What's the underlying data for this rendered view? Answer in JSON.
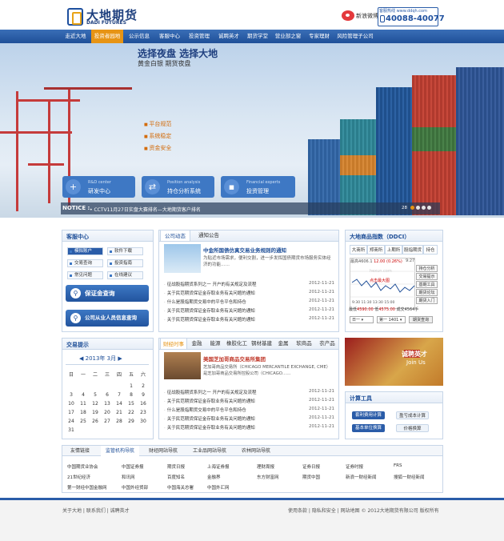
{
  "header": {
    "logo_cn": "大地期货",
    "logo_en": "DADI FUTURES",
    "weibo": "新浪微博",
    "hotline_top": "客服热线 www.ddqh.com",
    "hotline": "40088-40077"
  },
  "nav": [
    "走近大地",
    "投资者园地",
    "公示信息",
    "客服中心",
    "投资管理",
    "诚聘英才",
    "期货学堂",
    "营业部之窗",
    "专家理财",
    "风险管理子公司"
  ],
  "banner": {
    "title": "选择夜盘  选择大地",
    "subtitle": "黄金白银  期货夜盘",
    "bullets": [
      "平台规范",
      "系统稳定",
      "资金安全"
    ],
    "buttons": [
      {
        "en": "R&D center",
        "cn": "研发中心",
        "icon": "+"
      },
      {
        "en": "Position analysis",
        "cn": "持仓分析系统",
        "icon": "⇄"
      },
      {
        "en": "Financial experts",
        "cn": "投资管理",
        "icon": "▪"
      }
    ],
    "notice_label": "NOTICE :",
    "notice_text": "• CCTV11月27日实盘大赛排名—大地期货客户排名",
    "page_no": "28"
  },
  "service": {
    "title": "客服中心",
    "items": [
      "模拟账户",
      "软件下载",
      "交易查询",
      "投资指南",
      "常见问题",
      "在线建议"
    ],
    "query_btn": "保证金查询",
    "staff_btn": "公司从业人员信息查询"
  },
  "calendar": {
    "title": "交易提示",
    "year": "2013年",
    "month": "3月",
    "weekdays": [
      "日",
      "一",
      "二",
      "三",
      "四",
      "五",
      "六"
    ],
    "rows": [
      [
        "",
        "",
        "",
        "",
        "",
        "1",
        "2"
      ],
      [
        "3",
        "4",
        "5",
        "6",
        "7",
        "8",
        "9"
      ],
      [
        "10",
        "11",
        "12",
        "13",
        "14",
        "15",
        "16"
      ],
      [
        "17",
        "18",
        "19",
        "20",
        "21",
        "22",
        "23"
      ],
      [
        "24",
        "25",
        "26",
        "27",
        "28",
        "29",
        "30"
      ],
      [
        "31",
        "",
        "",
        "",
        "",
        "",
        ""
      ]
    ]
  },
  "company_news": {
    "tabs": [
      "公司动态",
      "通知公告"
    ],
    "headline": "中金所国债仿真交易业务规则的通知",
    "summary": "为贴近市场需求，便利交割，进一步发挥国债期货市场服务实体经济的功能……",
    "rows": [
      {
        "t": "征战股指期货系列之一 开户的有关规定及流程",
        "d": "2012-11-21"
      },
      {
        "t": "关于民范期货保证金存取业务有关问题的通知",
        "d": "2012-11-21"
      },
      {
        "t": "什么是股指期货交易中的平仓平仓和持仓",
        "d": "2012-11-21"
      },
      {
        "t": "关于民范期货保证金存取业务有关问题的通知",
        "d": "2012-11-21"
      },
      {
        "t": "关于民范期货保证金存取业务有关问题的通知",
        "d": "2012-11-21"
      }
    ]
  },
  "market_news": {
    "tabs": [
      "财经时事",
      "金融",
      "能源",
      "橡胶化工",
      "钢材基建",
      "金属",
      "软商品",
      "农产品"
    ],
    "headline": "美国芝加哥商品交易所集团",
    "summary": "芝加哥商品交易所（CHICAGO MERCANTILE EXCHANGE, CME）是芝加哥商品交易所控股公司（CHICAGO……",
    "rows": [
      {
        "t": "征战股指期货系列之一 开户的有关规定及流程",
        "d": "2012-11-21"
      },
      {
        "t": "关于民范期货保证金存取业务有关问题的通知",
        "d": "2012-11-21"
      },
      {
        "t": "什么是股指期货交易中的平仓平仓和持仓",
        "d": "2012-11-21"
      },
      {
        "t": "关于民范期货保证金存取业务有关问题的通知",
        "d": "2012-11-21"
      },
      {
        "t": "关于民范期货保证金存取业务有关问题的通知",
        "d": "2012-11-21"
      }
    ]
  },
  "index": {
    "title": "大地商品指数（DDCI）",
    "tabs": [
      "大商所",
      "郑商所",
      "上期所",
      "股指期货",
      "持仓"
    ],
    "side": [
      "持仓分析",
      "交易提示",
      "基期工具",
      "期货论坛",
      "期货入门"
    ],
    "high_lbl": "最高",
    "high": "4606.1",
    "change": "12.00 (0.26%)",
    "time": "9:27",
    "watermark": "hexun.com",
    "zoom": "点击最大图",
    "times": "9:30  11:30  13:30  15:00",
    "low_lbl": "最低",
    "low": "4590.00",
    "bottom_lbl": "低",
    "bottom": "4575.00",
    "volume": "成交4564手",
    "sel1": "日一",
    "sel2": "第一 1401",
    "query": "期货查询"
  },
  "recruit": {
    "cn": "诚聘英才",
    "en": "Join Us"
  },
  "tools": {
    "title": "计算工具",
    "buttons": [
      "套利费用计算",
      "盈亏成本计算",
      "基本单位换算",
      "价格换算"
    ]
  },
  "links": {
    "tabs": [
      "友情链接",
      "监管机构导航",
      "财经网站导航",
      "工业品网站导航",
      "农林网站导航"
    ],
    "rows": [
      [
        "中国期货业协会",
        "中国证券报",
        "期货日报",
        "上海证券报",
        "理财周报",
        "证券日报",
        "证券时报",
        "FRS"
      ],
      [
        "21世纪经济",
        "和讯网",
        "百度知名",
        "金融界",
        "东方财富网",
        "期货中国",
        "新浪一财经新闻",
        "搜狐一财经新闻"
      ],
      [
        "第一财经中国金融网",
        "中国外经贸部",
        "中国海关总署",
        "中国外汇网",
        "",
        "",
        "",
        ""
      ]
    ]
  },
  "footer": {
    "left": "关于大地  |  联系我们  |  诚聘英才",
    "right": "使用条款  |  隐私和安全  |  网站地图  ©  2012大地期货有限公司  版权所有"
  },
  "colors": {
    "brand_blue": "#1f4f98",
    "accent_orange": "#e79414"
  }
}
